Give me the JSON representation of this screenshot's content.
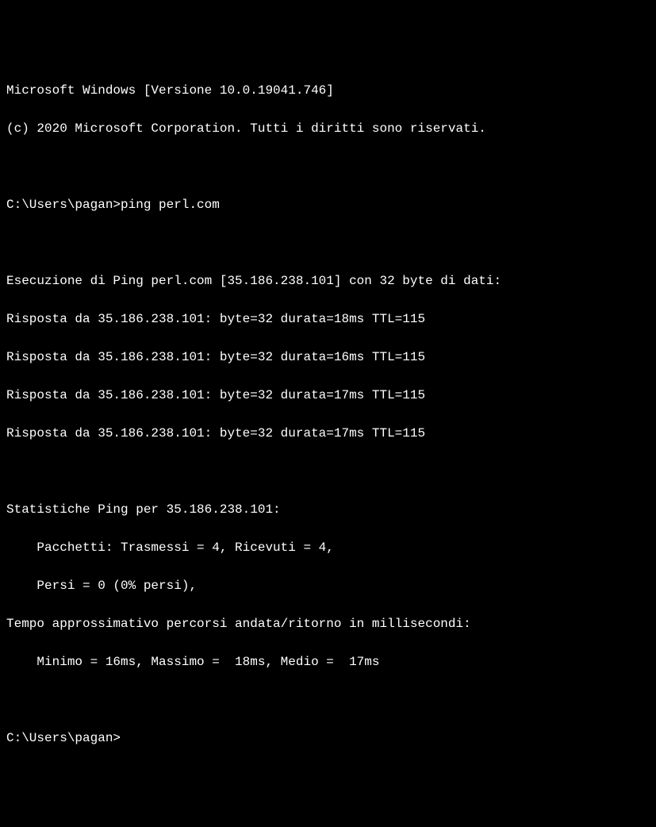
{
  "header": {
    "version_line": "Microsoft Windows [Versione 10.0.19041.746]",
    "copyright_line": "(c) 2020 Microsoft Corporation. Tutti i diritti sono riservati."
  },
  "command1": {
    "prompt": "C:\\Users\\pagan>",
    "command": "ping perl.com"
  },
  "ping": {
    "header": "Esecuzione di Ping perl.com [35.186.238.101] con 32 byte di dati:",
    "replies": [
      "Risposta da 35.186.238.101: byte=32 durata=18ms TTL=115",
      "Risposta da 35.186.238.101: byte=32 durata=16ms TTL=115",
      "Risposta da 35.186.238.101: byte=32 durata=17ms TTL=115",
      "Risposta da 35.186.238.101: byte=32 durata=17ms TTL=115"
    ],
    "stats_header": "Statistiche Ping per 35.186.238.101:",
    "packets_line": "    Pacchetti: Trasmessi = 4, Ricevuti = 4,",
    "lost_line": "    Persi = 0 (0% persi),",
    "timing_header": "Tempo approssimativo percorsi andata/ritorno in millisecondi:",
    "timing_line": "    Minimo = 16ms, Massimo =  18ms, Medio =  17ms"
  },
  "command2": {
    "prompt": "C:\\Users\\pagan>"
  }
}
